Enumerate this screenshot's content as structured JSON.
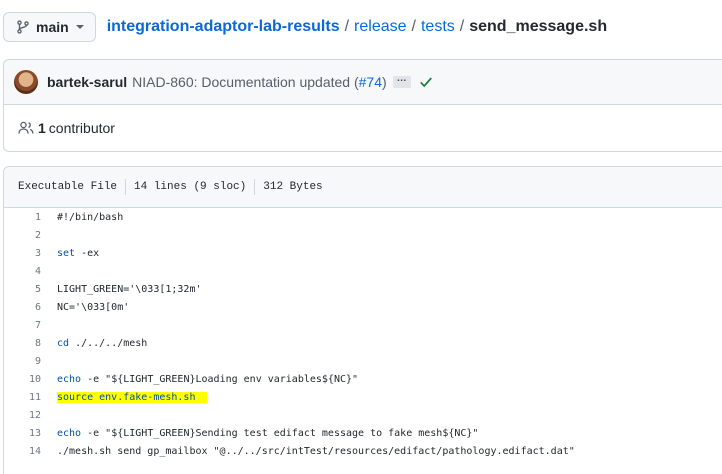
{
  "branch": {
    "label": "main"
  },
  "breadcrumb": {
    "repo": "integration-adaptor-lab-results",
    "sep": "/",
    "dir1": "release",
    "dir2": "tests",
    "file": "send_message.sh"
  },
  "commit": {
    "author": "bartek-sarul",
    "message": "NIAD-860: Documentation updated (",
    "pr": "#74",
    "message_end": ")",
    "ellipsis": "…",
    "status_color": "#1a7f37"
  },
  "contributors": {
    "count": "1",
    "label": "contributor"
  },
  "file_info": {
    "mode": "Executable File",
    "lines": "14 lines (9 sloc)",
    "size": "312 Bytes"
  },
  "code": {
    "highlight_color": "#ffff00",
    "lines": [
      {
        "n": "1",
        "t": "#!/bin/bash"
      },
      {
        "n": "2",
        "t": ""
      },
      {
        "n": "3",
        "a": "set",
        "b": " -ex"
      },
      {
        "n": "4",
        "t": ""
      },
      {
        "n": "5",
        "t": "LIGHT_GREEN='\\033[1;32m'"
      },
      {
        "n": "6",
        "t": "NC='\\033[0m'"
      },
      {
        "n": "7",
        "t": ""
      },
      {
        "n": "8",
        "a": "cd",
        "b": " ./../../mesh"
      },
      {
        "n": "9",
        "t": ""
      },
      {
        "n": "10",
        "a": "echo",
        "b": " -e \"${LIGHT_GREEN}Loading env variables${NC}\""
      },
      {
        "n": "11",
        "t": "source env.fake-mesh.sh"
      },
      {
        "n": "12",
        "t": ""
      },
      {
        "n": "13",
        "a": "echo",
        "b": " -e \"${LIGHT_GREEN}Sending test edifact message to fake mesh${NC}\""
      },
      {
        "n": "14",
        "t": "./mesh.sh send gp_mailbox \"@../../src/intTest/resources/edifact/pathology.edifact.dat\""
      }
    ]
  }
}
